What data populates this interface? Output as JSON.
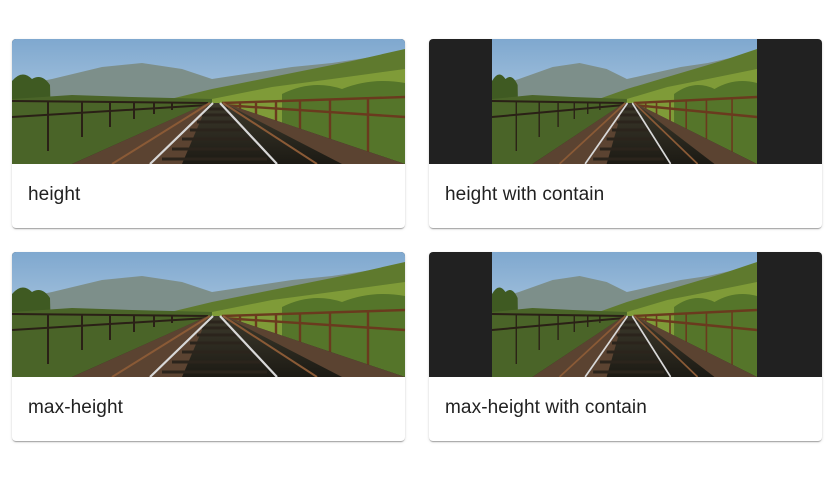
{
  "cards": [
    {
      "title": "height",
      "fit": "cover"
    },
    {
      "title": "height with contain",
      "fit": "contain"
    },
    {
      "title": "max-height",
      "fit": "cover"
    },
    {
      "title": "max-height with contain",
      "fit": "contain"
    }
  ],
  "colors": {
    "letterbox": "#212121",
    "card_background": "#ffffff",
    "text": "#212121"
  }
}
